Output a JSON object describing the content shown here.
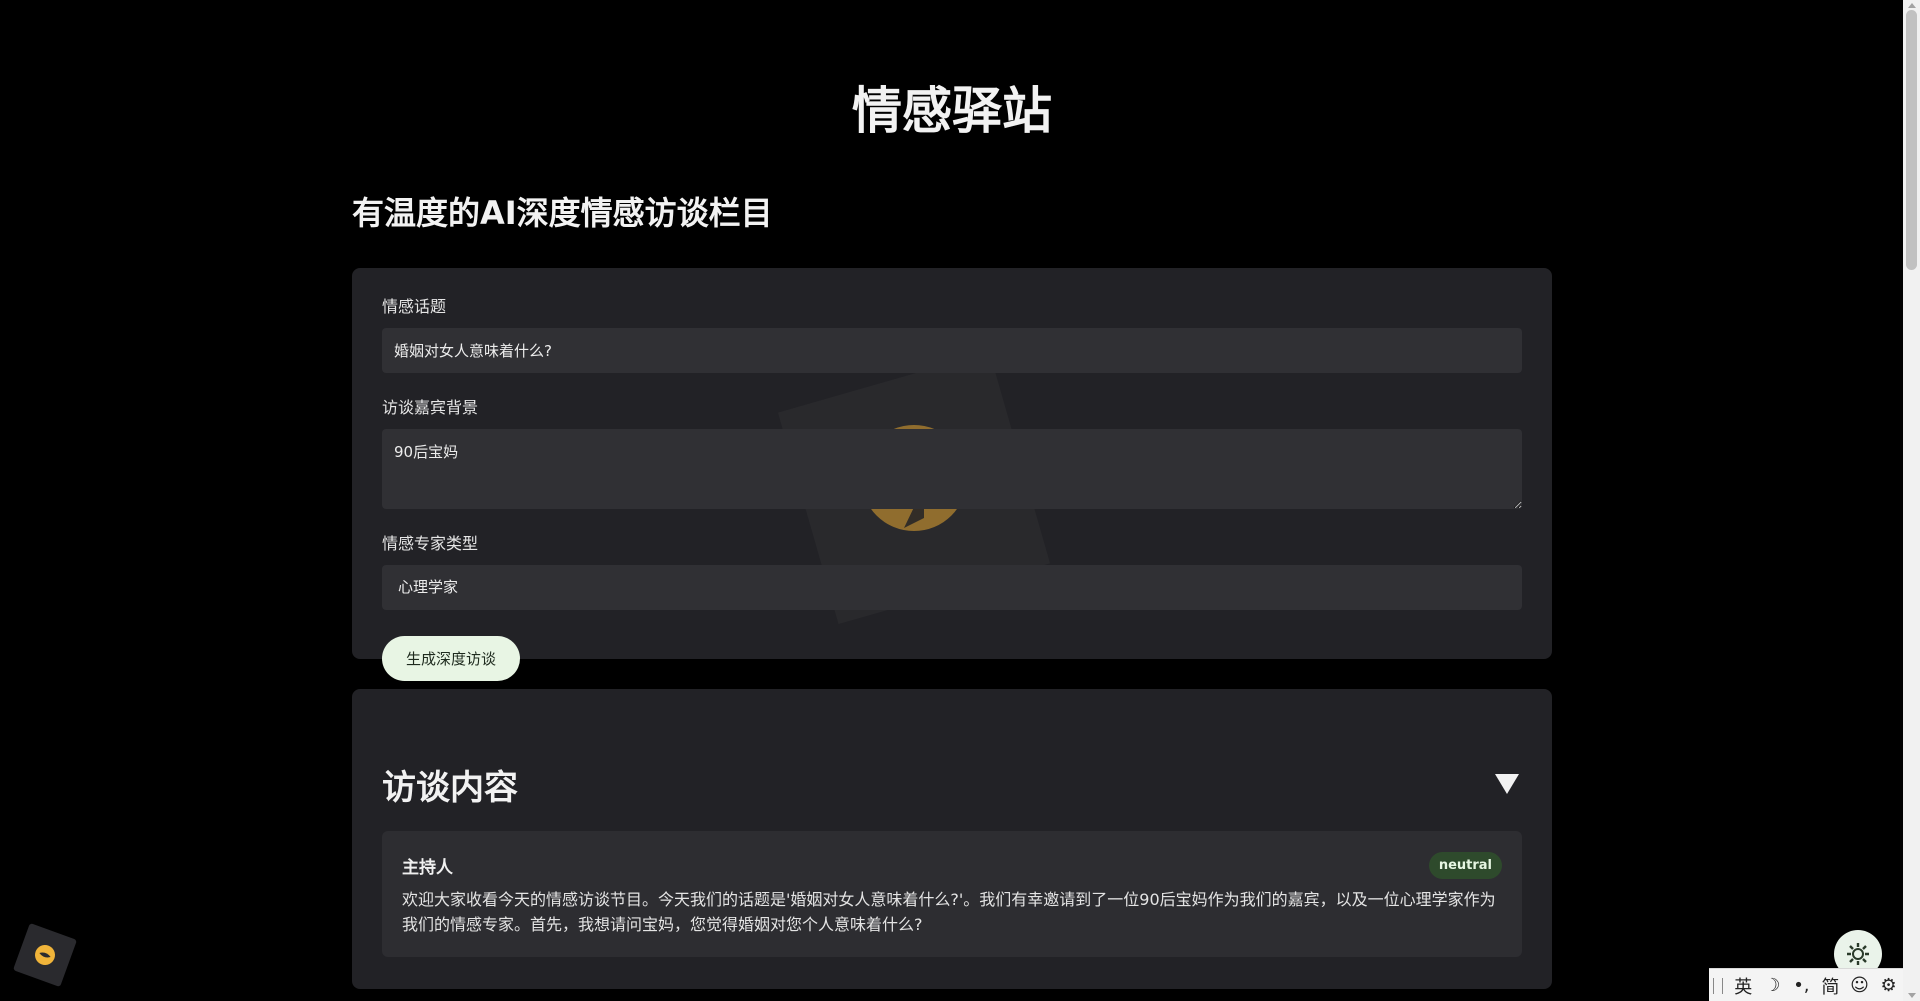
{
  "site_title": "情感驿站",
  "subtitle": "有温度的AI深度情感访谈栏目",
  "form": {
    "topic_label": "情感话题",
    "topic_value": "婚姻对女人意味着什么?",
    "guest_label": "访谈嘉宾背景",
    "guest_value": "90后宝妈",
    "expert_label": "情感专家类型",
    "expert_selected": "心理学家",
    "submit_label": "生成深度访谈"
  },
  "interview": {
    "section_title": "访谈内容",
    "collapse_glyph": "▼",
    "messages": [
      {
        "speaker": "主持人",
        "emotion": "neutral",
        "text": "欢迎大家收看今天的情感访谈节目。今天我们的话题是'婚姻对女人意味着什么?'。我们有幸邀请到了一位90后宝妈作为我们的嘉宾，以及一位心理学家作为我们的情感专家。首先，我想请问宝妈，您觉得婚姻对您个人意味着什么?"
      }
    ]
  },
  "ime": {
    "lang": "英",
    "moon": "☽",
    "punct": "•,",
    "charset": "简",
    "emoji": "☺",
    "settings": "⚙"
  },
  "colors": {
    "background": "#000000",
    "card": "#222226",
    "input": "#303034",
    "button_bg": "#e8f5e4",
    "badge_bg": "#2e4a2c",
    "watermark_gold": "#c8922f"
  },
  "icons": {
    "collapse": "triangle-down-icon",
    "select": "chevron-down-icon",
    "avatar": "moon-logo-icon",
    "settings": "gear-icon",
    "watermark": "music-note-logo-icon"
  }
}
